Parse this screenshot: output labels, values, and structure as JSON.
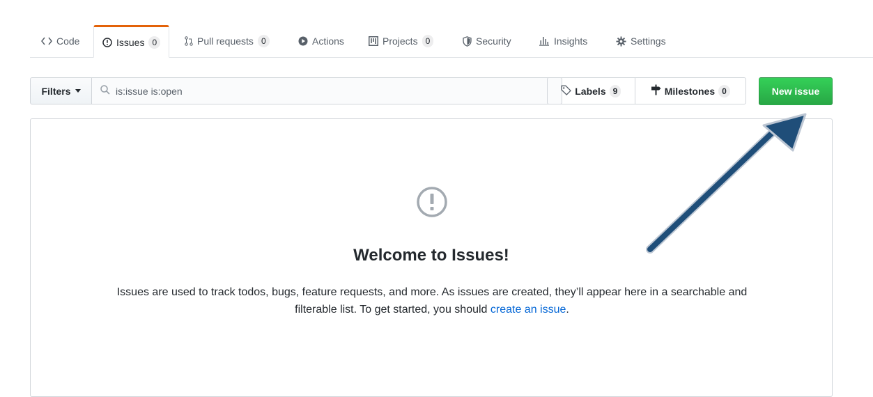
{
  "tabs": [
    {
      "label": "Code",
      "icon": "code-icon"
    },
    {
      "label": "Issues",
      "count": "0",
      "icon": "issue-opened-icon",
      "selected": true
    },
    {
      "label": "Pull requests",
      "count": "0",
      "icon": "git-pull-request-icon"
    },
    {
      "label": "Actions",
      "icon": "play-icon"
    },
    {
      "label": "Projects",
      "count": "0",
      "icon": "project-icon"
    },
    {
      "label": "Security",
      "icon": "shield-icon"
    },
    {
      "label": "Insights",
      "icon": "graph-icon"
    },
    {
      "label": "Settings",
      "icon": "gear-icon"
    }
  ],
  "subnav": {
    "filters_label": "Filters",
    "search_value": "is:issue is:open",
    "labels_label": "Labels",
    "labels_count": "9",
    "milestones_label": "Milestones",
    "milestones_count": "0",
    "new_issue_label": "New issue"
  },
  "blankslate": {
    "title": "Welcome to Issues!",
    "text_part1": "Issues are used to track todos, bugs, feature requests, and more. As issues are created, they’ll appear here in a searchable and filterable list. To get started, you should ",
    "link_text": "create an issue",
    "text_part2": "."
  },
  "colors": {
    "accent_tab": "#e36209",
    "primary_button": "#28a745",
    "link": "#0366d6",
    "annotation_arrow": "#1f4e79"
  }
}
